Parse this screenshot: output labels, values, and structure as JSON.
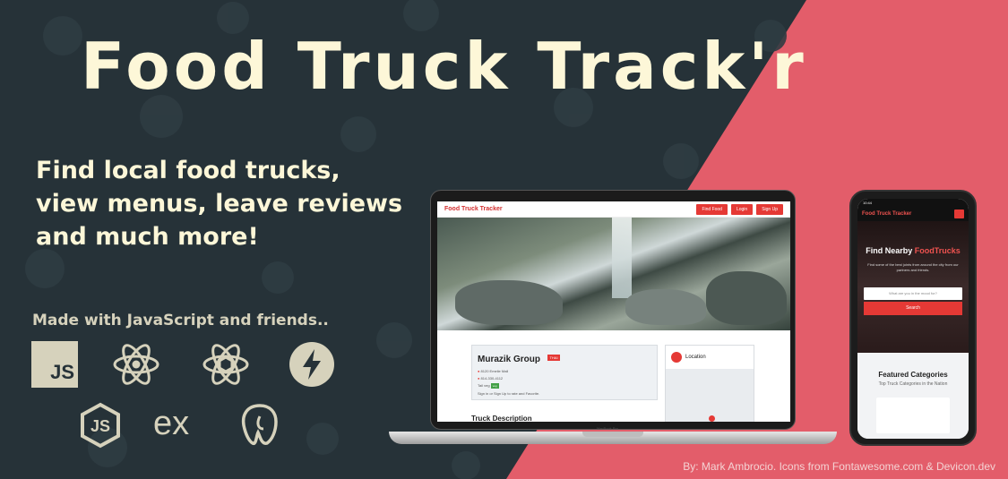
{
  "banner": {
    "title": "Food Truck Track'r",
    "tagline": [
      "Find local food trucks,",
      "view menus, leave reviews",
      "and much more!"
    ],
    "made_with": "Made with JavaScript and friends..",
    "tech": [
      "JS",
      "ex"
    ],
    "credit": "By: Mark Ambrocio. Icons from Fontawesome.com & Devicon.dev"
  },
  "colors": {
    "dark": "#263238",
    "accent": "#e35d6a",
    "cream": "#fdf7d8",
    "red": "#e53935"
  },
  "laptop": {
    "brand": "Food Truck Tracker",
    "nav": [
      "Find Food",
      "Login",
      "Sign Up"
    ],
    "truck_name": "Murazik Group",
    "badge": "THAI",
    "address": "8120 Emelie Mall",
    "phone": "814-330-4112",
    "tag_label": "Tail veg",
    "tag": "veg",
    "signin_note": "Sign in or Sign Up to rate and Favorite.",
    "location": "Location",
    "description": "Truck Description",
    "device": "MacBook Pro"
  },
  "phone": {
    "time": "10:44",
    "brand": "Food Truck Tracker",
    "hero_title_plain": "Find Nearby",
    "hero_title_accent": "FoodTrucks",
    "hero_sub": "Find some of the best joints from around the city from our partners and friends.",
    "search_placeholder": "What are you in the mood for?",
    "search_button": "Search",
    "featured_title": "Featured Categories",
    "featured_sub": "Top Truck Categories in the Nation"
  }
}
